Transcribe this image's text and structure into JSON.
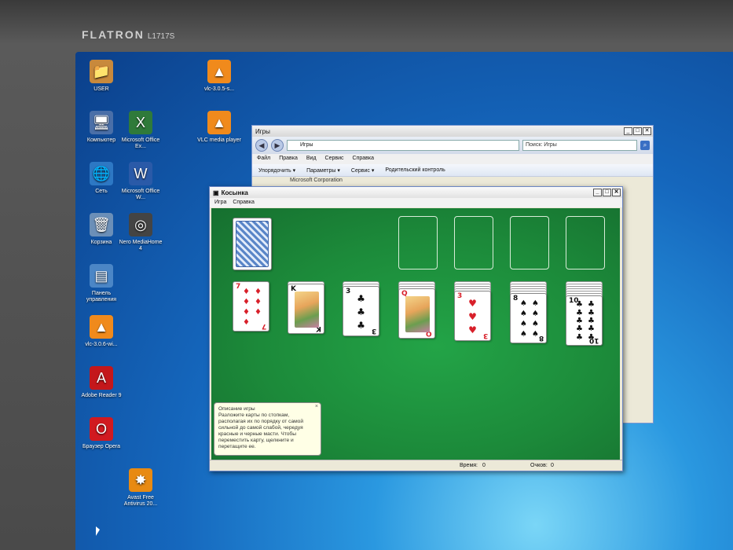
{
  "monitor": {
    "brand": "FLATRON",
    "model": "L1717S"
  },
  "desktop": {
    "icons": [
      {
        "label": "USER",
        "glyph": "📁",
        "color": "#c8893c"
      },
      {
        "label": "vlc-3.0.5-s...",
        "glyph": "▲",
        "color": "#f08a1c"
      },
      {
        "label": "Компьютер",
        "glyph": "🖥",
        "color": "#4a6fa8"
      },
      {
        "label": "Microsoft Office Ex...",
        "glyph": "X",
        "color": "#2f7a3a"
      },
      {
        "label": "VLC media player",
        "glyph": "▲",
        "color": "#f08a1c"
      },
      {
        "label": "Сеть",
        "glyph": "🌐",
        "color": "#2d78c4"
      },
      {
        "label": "Microsoft Office W...",
        "glyph": "W",
        "color": "#2a5aa8"
      },
      {
        "label": "Корзина",
        "glyph": "🗑",
        "color": "#6b8fb8"
      },
      {
        "label": "Nero MediaHome 4",
        "glyph": "◎",
        "color": "#444"
      },
      {
        "label": "Панель управления",
        "glyph": "▤",
        "color": "#4b86c6"
      },
      {
        "label": "vlc-3.0.6-wi...",
        "glyph": "▲",
        "color": "#f08a1c"
      },
      {
        "label": "Adobe Reader 9",
        "glyph": "A",
        "color": "#c4171b"
      },
      {
        "label": "Браузер Opera",
        "glyph": "O",
        "color": "#d11a20"
      },
      {
        "label": "Avast Free Antivirus 20...",
        "glyph": "✸",
        "color": "#e88a12"
      }
    ]
  },
  "explorer": {
    "title": "Игры",
    "address": "Игры",
    "search_placeholder": "Поиск: Игры",
    "menu": [
      "Файл",
      "Правка",
      "Вид",
      "Сервис",
      "Справка"
    ],
    "commands": [
      "Упорядочить",
      "Параметры",
      "Сервис",
      "Родительский контроль"
    ],
    "partial_text": "Microsoft Corporation"
  },
  "solitaire": {
    "title": "Косынка",
    "menu": [
      "Игра",
      "Справка"
    ],
    "status": {
      "time_label": "Время:",
      "time_value": "0",
      "score_label": "Очков:",
      "score_value": "0"
    },
    "balloon": {
      "title": "Описание игры",
      "text": "Разложите карты по стопкам, располагая их по порядку от самой сильной до самой слабой, чередуя красные и черные масти. Чтобы переместить карту, щелкните и перетащите ее."
    },
    "tableau": [
      {
        "rank": "7",
        "suit": "♦",
        "color": "red",
        "hidden": 0
      },
      {
        "rank": "K",
        "suit": "♣",
        "color": "black",
        "hidden": 1,
        "face": true
      },
      {
        "rank": "3",
        "suit": "♣",
        "color": "black",
        "hidden": 2
      },
      {
        "rank": "Q",
        "suit": "♥",
        "color": "red",
        "hidden": 3,
        "face": true
      },
      {
        "rank": "3",
        "suit": "♥",
        "color": "red",
        "hidden": 4
      },
      {
        "rank": "8",
        "suit": "♠",
        "color": "black",
        "hidden": 5
      },
      {
        "rank": "10",
        "suit": "♣",
        "color": "black",
        "hidden": 6
      }
    ]
  }
}
